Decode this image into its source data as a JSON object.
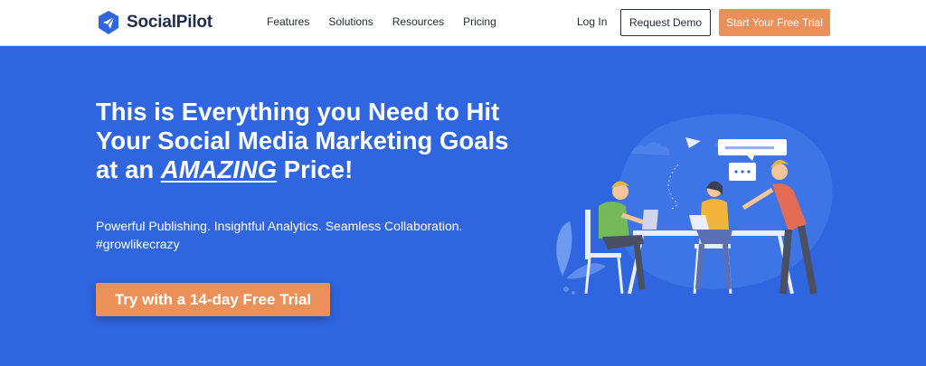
{
  "brand": {
    "name": "SocialPilot"
  },
  "nav": {
    "items": [
      {
        "label": "Features"
      },
      {
        "label": "Solutions"
      },
      {
        "label": "Resources"
      },
      {
        "label": "Pricing"
      }
    ],
    "login": "Log In",
    "request_demo": "Request Demo",
    "start_trial": "Start Your Free Trial"
  },
  "hero": {
    "title_line1": "This is Everything you Need to Hit",
    "title_line2": "Your Social Media Marketing Goals",
    "title_prefix": "at an ",
    "title_emphasis": "AMAZING",
    "title_suffix": " Price!",
    "subtitle_line1": "Powerful Publishing. Insightful Analytics. Seamless Collaboration.",
    "subtitle_line2": "#growlikecrazy",
    "cta": "Try with a 14-day Free Trial"
  },
  "colors": {
    "hero_bg": "#2f66e0",
    "accent_orange": "#ec9059",
    "nav_text": "#222a3a"
  },
  "icons": {
    "logo": "paper-plane-logo-icon"
  }
}
